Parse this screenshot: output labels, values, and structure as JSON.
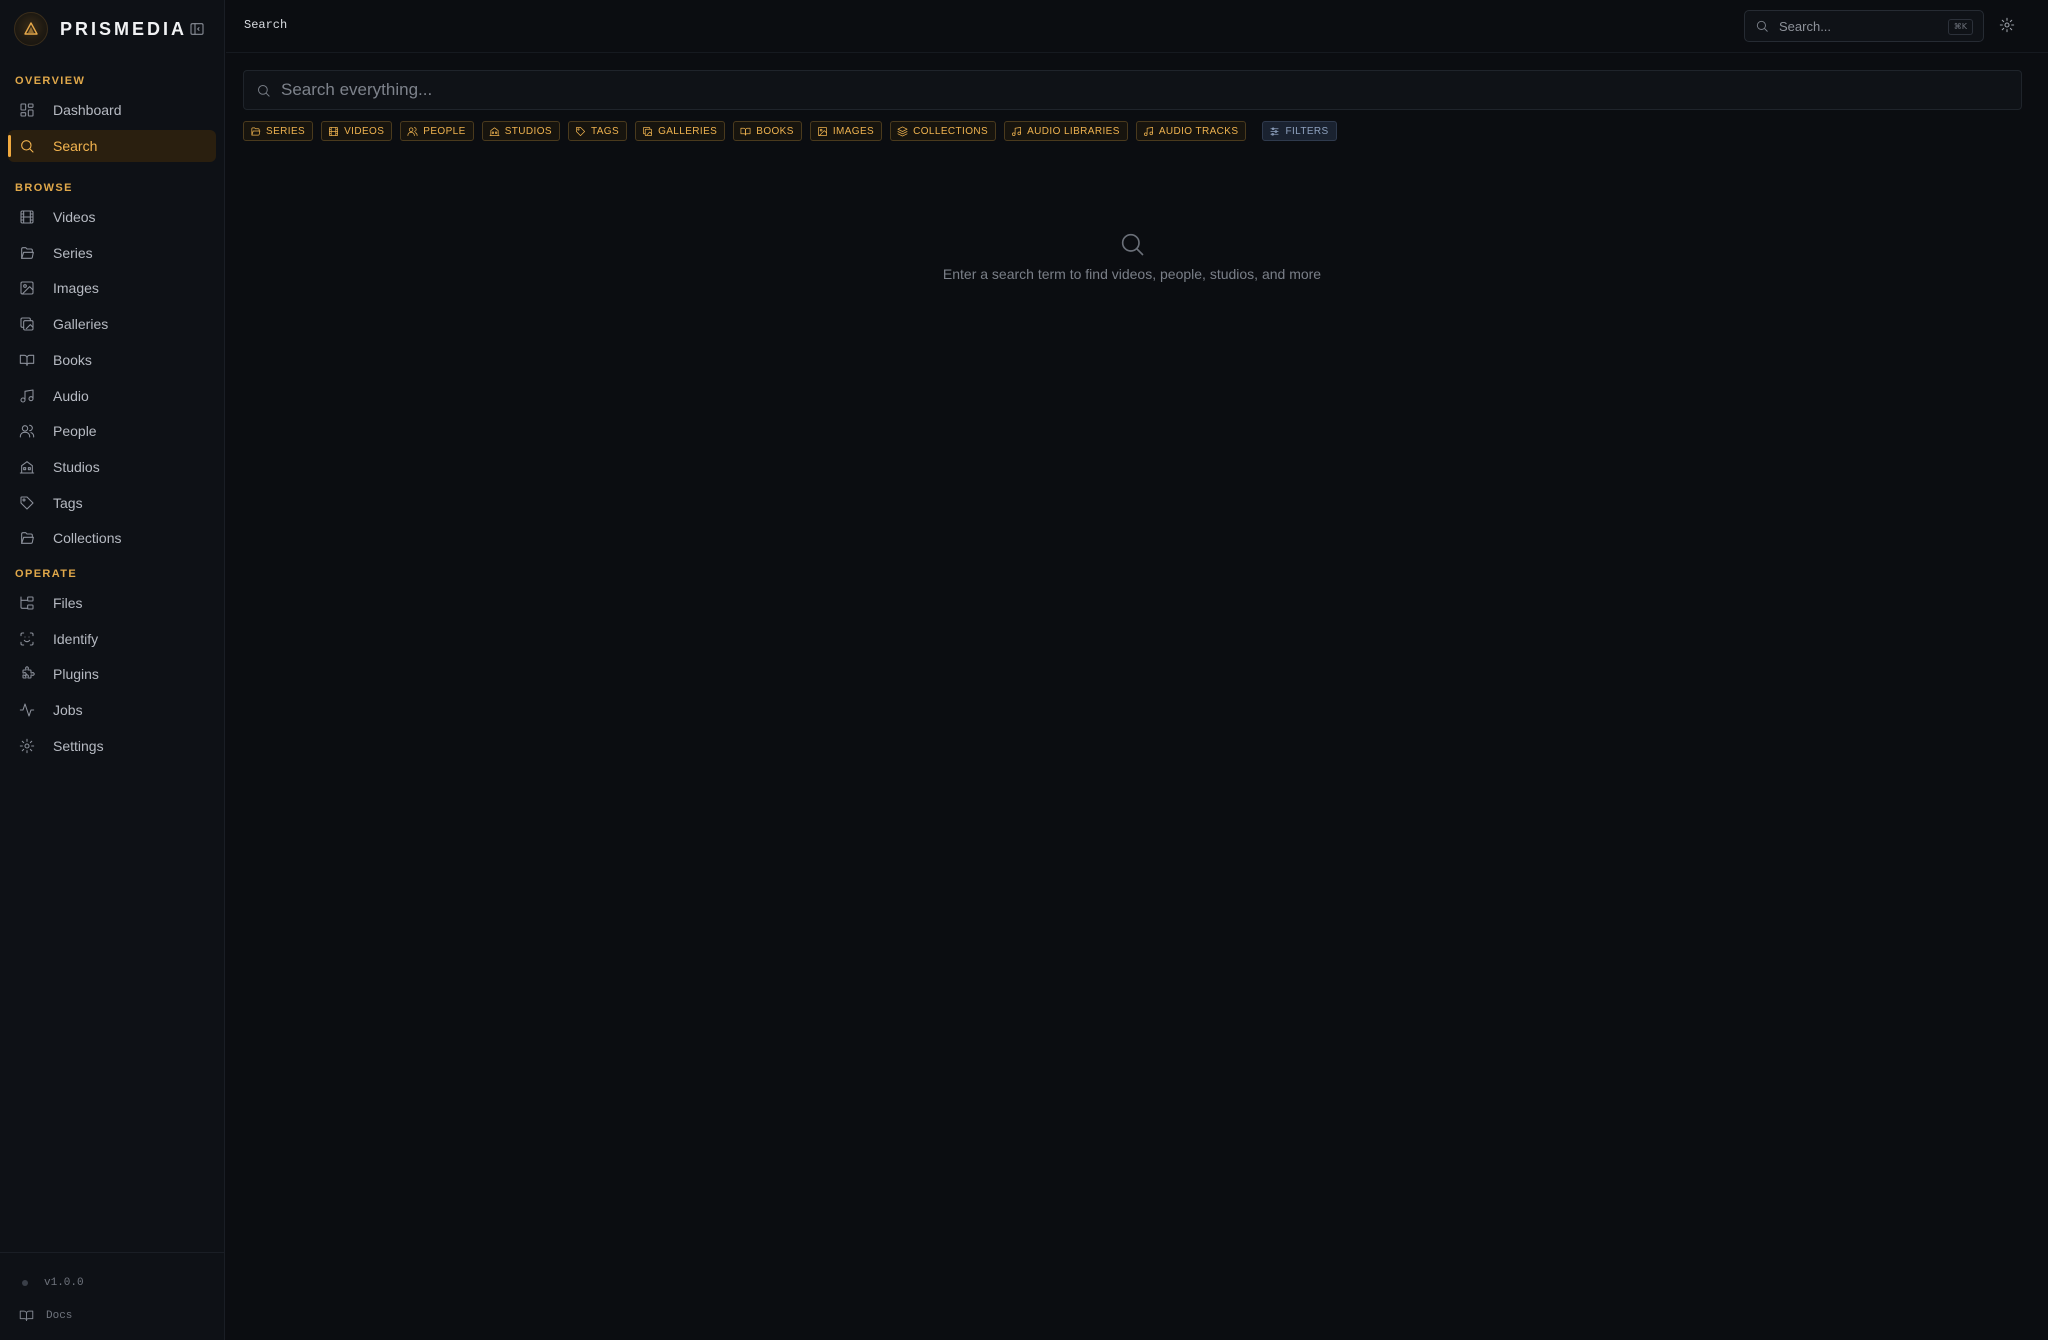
{
  "brand": {
    "name": "PRISMEDIA"
  },
  "sidebar": {
    "sections": [
      {
        "label": "OVERVIEW",
        "items": [
          {
            "label": "Dashboard",
            "icon": "dashboard-icon"
          },
          {
            "label": "Search",
            "icon": "search-icon",
            "active": true
          }
        ]
      },
      {
        "label": "BROWSE",
        "items": [
          {
            "label": "Videos",
            "icon": "film-icon"
          },
          {
            "label": "Series",
            "icon": "folder-open-icon"
          },
          {
            "label": "Images",
            "icon": "image-icon"
          },
          {
            "label": "Galleries",
            "icon": "galleries-icon"
          },
          {
            "label": "Books",
            "icon": "book-open-icon"
          },
          {
            "label": "Audio",
            "icon": "music-note-icon"
          },
          {
            "label": "People",
            "icon": "users-icon"
          },
          {
            "label": "Studios",
            "icon": "building-icon"
          },
          {
            "label": "Tags",
            "icon": "tag-icon"
          },
          {
            "label": "Collections",
            "icon": "folder-icon"
          }
        ]
      },
      {
        "label": "OPERATE",
        "items": [
          {
            "label": "Files",
            "icon": "folder-tree-icon"
          },
          {
            "label": "Identify",
            "icon": "scan-face-icon"
          },
          {
            "label": "Plugins",
            "icon": "puzzle-icon"
          },
          {
            "label": "Jobs",
            "icon": "activity-icon"
          },
          {
            "label": "Settings",
            "icon": "gear-icon"
          }
        ]
      }
    ],
    "footer": {
      "version": "v1.0.0",
      "docs": "Docs"
    }
  },
  "header": {
    "breadcrumb": "Search",
    "search_placeholder": "Search...",
    "shortcut": "⌘K"
  },
  "main": {
    "search_placeholder": "Search everything...",
    "chips": [
      {
        "label": "SERIES",
        "icon": "folder-open-icon"
      },
      {
        "label": "VIDEOS",
        "icon": "film-icon"
      },
      {
        "label": "PEOPLE",
        "icon": "users-icon"
      },
      {
        "label": "STUDIOS",
        "icon": "building-icon"
      },
      {
        "label": "TAGS",
        "icon": "tag-icon"
      },
      {
        "label": "GALLERIES",
        "icon": "galleries-icon"
      },
      {
        "label": "BOOKS",
        "icon": "book-open-icon"
      },
      {
        "label": "IMAGES",
        "icon": "image-icon"
      },
      {
        "label": "COLLECTIONS",
        "icon": "layers-icon"
      },
      {
        "label": "AUDIO LIBRARIES",
        "icon": "music-note-icon"
      },
      {
        "label": "AUDIO TRACKS",
        "icon": "music-note-icon"
      }
    ],
    "filters_label": "FILTERS",
    "empty_text": "Enter a search term to find videos, people, studios, and more"
  },
  "colors": {
    "accent": "#f0a93f",
    "background": "#0b0d11",
    "sidebar_bg": "#0e1116",
    "filters_chip": "#1a2230"
  }
}
